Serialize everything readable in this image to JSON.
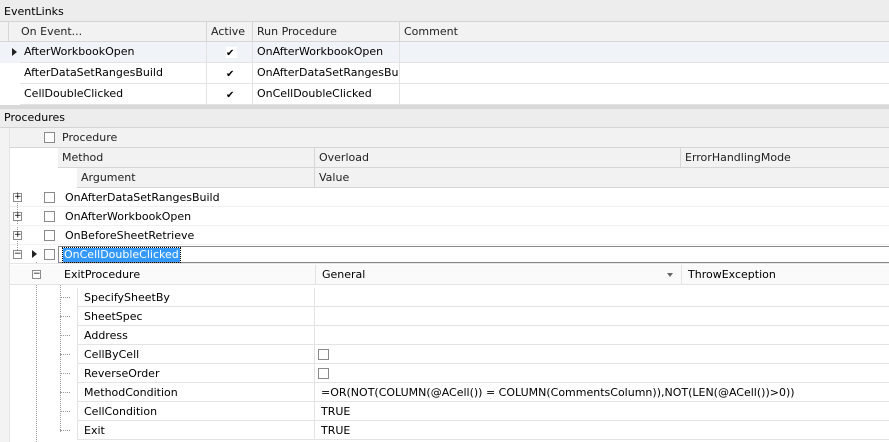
{
  "event_links": {
    "title": "EventLinks",
    "columns": [
      "On Event...",
      "Active",
      "Run Procedure",
      "Comment"
    ],
    "rows": [
      {
        "event": "AfterWorkbookOpen",
        "active": true,
        "procedure": "OnAfterWorkbookOpen",
        "comment": ""
      },
      {
        "event": "AfterDataSetRangesBuild",
        "active": true,
        "procedure": "OnAfterDataSetRangesBuil",
        "comment": ""
      },
      {
        "event": "CellDoubleClicked",
        "active": true,
        "procedure": "OnCellDoubleClicked",
        "comment": ""
      }
    ]
  },
  "procedures": {
    "title": "Procedures",
    "header_procedure": "Procedure",
    "header_method": "Method",
    "header_overload": "Overload",
    "header_error_mode": "ErrorHandlingMode",
    "header_argument": "Argument",
    "header_value": "Value",
    "items": [
      {
        "name": "OnAfterDataSetRangesBuild"
      },
      {
        "name": "OnAfterWorkbookOpen"
      },
      {
        "name": "OnBeforeSheetRetrieve"
      },
      {
        "name": "OnCellDoubleClicked"
      }
    ],
    "method": {
      "name": "ExitProcedure",
      "overload": "General",
      "error_mode": "ThrowException"
    },
    "arguments": [
      {
        "name": "SpecifySheetBy",
        "value": ""
      },
      {
        "name": "SheetSpec",
        "value": ""
      },
      {
        "name": "Address",
        "value": ""
      },
      {
        "name": "CellByCell",
        "value": "",
        "checkbox": true
      },
      {
        "name": "ReverseOrder",
        "value": "",
        "checkbox": true
      },
      {
        "name": "MethodCondition",
        "value": "=OR(NOT(COLUMN(@ACell()) = COLUMN(CommentsColumn)),NOT(LEN(@ACell())>0))"
      },
      {
        "name": "CellCondition",
        "value": "TRUE"
      },
      {
        "name": "Exit",
        "value": "TRUE"
      }
    ]
  }
}
